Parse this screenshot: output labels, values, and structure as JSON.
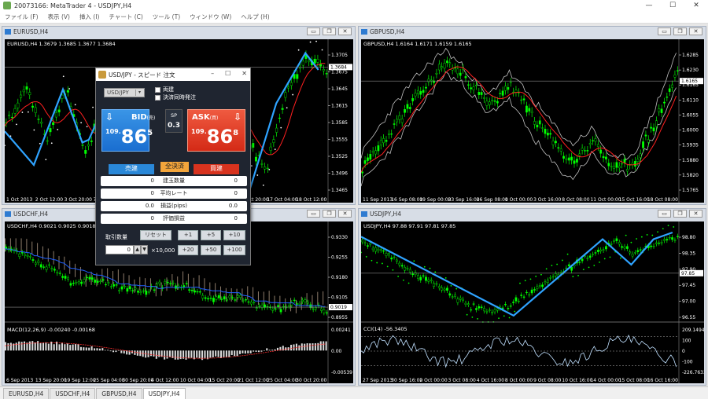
{
  "window": {
    "title": "20073166: MetaTrader 4 - USDJPY,H4",
    "minimize": "—",
    "maximize": "☐",
    "close": "✕"
  },
  "menu": [
    "ファイル (F)",
    "表示 (V)",
    "挿入 (I)",
    "チャート (C)",
    "ツール (T)",
    "ウィンドウ (W)",
    "ヘルプ (H)"
  ],
  "charts": {
    "eurusd": {
      "title": "EURUSD,H4",
      "info": "EURUSD,H4  1.3679 1.3685 1.3677 1.3684",
      "price_current": "1.3684",
      "yticks": [
        "1.3705",
        "1.3675",
        "1.3645",
        "1.3615",
        "1.3585",
        "1.3555",
        "1.3525",
        "1.3496",
        "1.3465"
      ],
      "xticks": [
        "1 Oct 2013",
        "2 Oct 12:00",
        "3 Oct 20:00",
        "7 Oct 04:00",
        "8 Oct 12:00",
        "9 Oct 20:00",
        "11 Oct 04:00",
        "14 Oct 12:00",
        "15 Oct 20:00",
        "17 Oct 04:00",
        "18 Oct 12:00"
      ],
      "colors": {
        "candle": "#00ff00",
        "zigzag": "#2fa3ff",
        "ma": "#ff2020",
        "sar": "#ffffff"
      }
    },
    "gbpusd": {
      "title": "GBPUSD,H4",
      "info": "GBPUSD,H4  1.6164 1.6171 1.6159 1.6165",
      "price_current": "1.6165",
      "yticks": [
        "1.6285",
        "1.6230",
        "1.6165",
        "1.6110",
        "1.6055",
        "1.6000",
        "1.5935",
        "1.5880",
        "1.5820",
        "1.5765"
      ],
      "xticks": [
        "11 Sep 2013",
        "16 Sep 08:00",
        "19 Sep 00:00",
        "23 Sep 16:00",
        "26 Sep 08:00",
        "1 Oct 00:00",
        "3 Oct 16:00",
        "8 Oct 08:00",
        "11 Oct 00:00",
        "15 Oct 16:00",
        "18 Oct 08:00"
      ],
      "colors": {
        "candle": "#00ff00",
        "band": "#c0c0c0",
        "ma": "#ff2020"
      }
    },
    "usdchf": {
      "title": "USDCHF,H4",
      "info": "USDCHF,H4  0.9021 0.9025 0.9018 0.9019",
      "price_current": "0.9019",
      "yticks": [
        "0.9330",
        "0.9255",
        "0.9180",
        "0.9105",
        "0.8955"
      ],
      "macd_label": "MACD(12,26,9) -0.00240 -0.00168",
      "macd_yticks": [
        "0.00241",
        "0.00",
        "-0.00539"
      ],
      "xticks": [
        "6 Sep 2013",
        "13 Sep 20:00",
        "19 Sep 12:00",
        "25 Sep 04:00",
        "30 Sep 20:00",
        "4 Oct 12:00",
        "10 Oct 04:00",
        "15 Oct 20:00",
        "21 Oct 12:00",
        "25 Oct 04:00",
        "30 Oct 20:00"
      ],
      "colors": {
        "candle": "#00ff00",
        "cloud": "#ffe0c0",
        "kijun": "#2060ff",
        "macd": "#ffffff",
        "signal": "#ff3030"
      }
    },
    "usdjpy": {
      "title": "USDJPY,H4",
      "info": "USDJPY,H4  97.88 97.91 97.81 97.85",
      "price_current": "97.85",
      "yticks": [
        "98.80",
        "98.35",
        "97.90",
        "97.45",
        "97.00",
        "96.55"
      ],
      "cci_label": "CCI(14) -56.3405",
      "cci_yticks": [
        "209.1494",
        "100",
        "0",
        "-100",
        "-226.7633"
      ],
      "xticks": [
        "27 Sep 2013",
        "30 Sep 16:00",
        "2 Oct 00:00",
        "3 Oct 08:00",
        "4 Oct 16:00",
        "8 Oct 00:00",
        "9 Oct 08:00",
        "10 Oct 16:00",
        "14 Oct 00:00",
        "15 Oct 08:00",
        "16 Oct 16:00"
      ],
      "colors": {
        "candle": "#00ff00",
        "zigzag": "#2fa3ff",
        "sar": "#00ff00",
        "cci": "#c0e0ff"
      }
    }
  },
  "dialog": {
    "title": "USD/JPY - スピード 注文",
    "symbol": "USD/JPY",
    "check_both": "両建",
    "check_settle": "決済同時発注",
    "bid": {
      "label": "BID",
      "sub": "(売)",
      "small": "109.",
      "big": "86",
      "pip": "5"
    },
    "ask": {
      "label": "ASK",
      "sub": "(買)",
      "small": "109.",
      "big": "86",
      "pip": "8"
    },
    "spread_label": "SP",
    "spread_value": "0.3",
    "sell_tab": "売建",
    "close_all": "全決済",
    "buy_tab": "買建",
    "rows": [
      {
        "left": "0",
        "label": "建玉数量",
        "right": "0"
      },
      {
        "left": "0",
        "label": "平均レート",
        "right": "0"
      },
      {
        "left": "0.0",
        "label": "損益(pips)",
        "right": "0.0"
      },
      {
        "left": "0",
        "label": "評価損益",
        "right": "0"
      }
    ],
    "qty_label": "取引数量",
    "reset": "リセット",
    "add1": "+1",
    "add5": "+5",
    "add10": "+10",
    "add20": "+20",
    "add50": "+50",
    "add100": "+100",
    "qty_value": "0",
    "multiplier": "×10,000"
  },
  "tabs": [
    "EURUSD,H4",
    "USDCHF,H4",
    "GBPUSD,H4",
    "USDJPY,H4"
  ],
  "active_tab": "USDJPY,H4"
}
